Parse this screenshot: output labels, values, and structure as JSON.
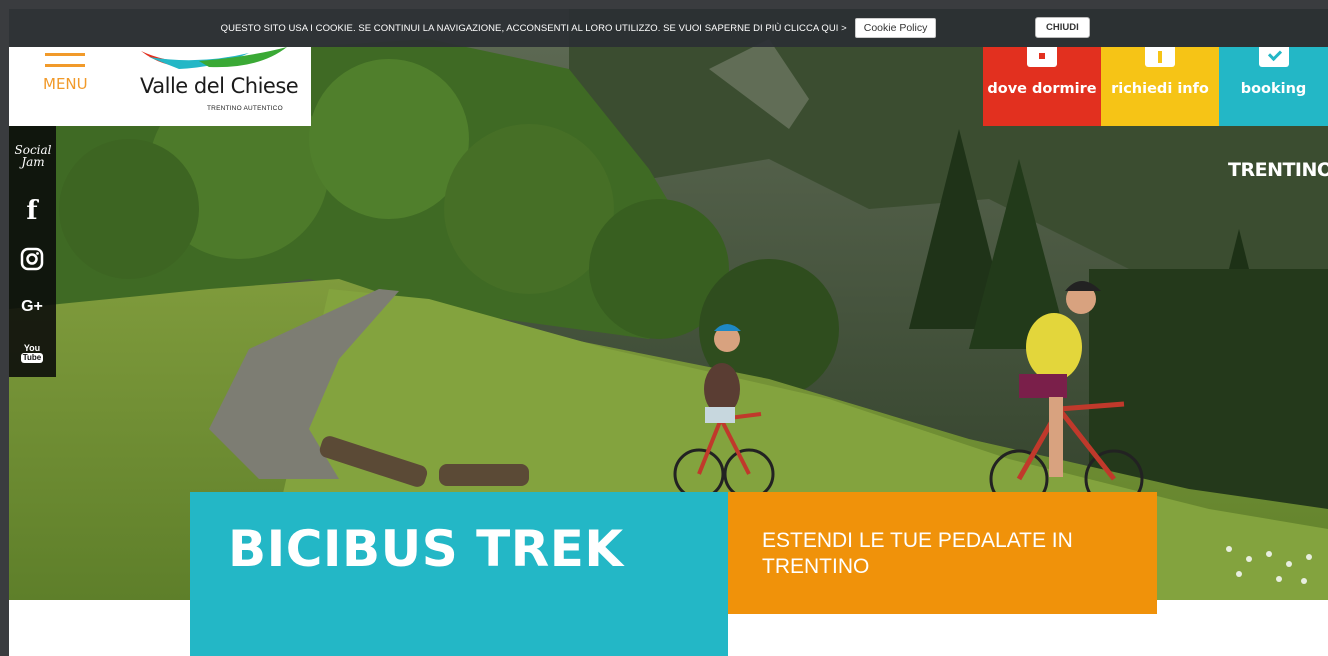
{
  "cookie_bar": {
    "message": "QUESTO SITO USA I COOKIE. SE CONTINUI LA NAVIGAZIONE, ACCONSENTI AL LORO UTILIZZO. SE VUOI SAPERNE DI PIÙ CLICCA QUI >",
    "policy_button": "Cookie Policy",
    "close_button": "CHIUDI"
  },
  "header": {
    "menu_label": "MENU",
    "logo_title": "Valle del Chiese",
    "logo_subtitle": "TRENTINO AUTENTICO",
    "buttons": [
      {
        "label": "dove dormire",
        "icon": "bed-icon",
        "color": "#e2301f"
      },
      {
        "label": "richiedi info",
        "icon": "info-icon",
        "color": "#f6c416"
      },
      {
        "label": "booking",
        "icon": "checkmark-icon",
        "color": "#23b7c6"
      }
    ]
  },
  "social": {
    "title": "Social Jam",
    "items": [
      {
        "name": "facebook",
        "icon": "facebook-icon",
        "glyph": "f"
      },
      {
        "name": "instagram",
        "icon": "instagram-icon"
      },
      {
        "name": "google-plus",
        "icon": "google-plus-icon",
        "glyph": "G+"
      },
      {
        "name": "youtube",
        "icon": "youtube-icon",
        "glyph_top": "You",
        "glyph_bottom": "Tube"
      }
    ]
  },
  "brand": {
    "trentino": "TRENTINO"
  },
  "hero": {
    "title": "BICIBUS TREK",
    "subtitle": "ESTENDI LE TUE PEDALATE IN TRENTINO",
    "title_color": "#23b7c6",
    "subtitle_color": "#f0920a"
  }
}
